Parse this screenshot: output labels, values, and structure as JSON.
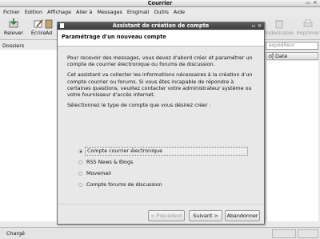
{
  "window": {
    "title": "Courrier"
  },
  "menubar": {
    "items": [
      "Fichier",
      "Edition",
      "Affichage",
      "Aller à",
      "Messages",
      "Enigmail",
      "Outils",
      "Aide"
    ]
  },
  "toolbar": {
    "relever": "Relever",
    "ecrire": "Écrire",
    "ad_partial": "Ad",
    "indesirable": "Indésirable",
    "imprimer": "Imprimer"
  },
  "folders": {
    "header": "Dossiers"
  },
  "search": {
    "placeholder": "expéditeur"
  },
  "columns": {
    "date": "Date"
  },
  "status": {
    "text": "Chargé"
  },
  "dialog": {
    "title": "Assistant de création de compte",
    "heading": "Paramétrage d'un nouveau compte",
    "paragraph1": "Pour recevoir des messages, vous devez d'abord créer et paramétrer un compte de courrier électronique ou forums de discussion.",
    "paragraph2": "Cet assistant va collecter les informations nécessaires à la création d'un compte courrier ou forums. Si vous êtes incapable de répondre à certaines questions, veuillez contacter votre administrateur système ou votre fournisseur d'accès internet.",
    "paragraph3": "Sélectionnez le type de compte que vous désirez créer :",
    "options": [
      {
        "label": "Compte courrier électronique",
        "selected": true
      },
      {
        "label": "RSS News & Blogs",
        "selected": false
      },
      {
        "label": "Movemail",
        "selected": false
      },
      {
        "label": "Compte forums de discussion",
        "selected": false
      }
    ],
    "buttons": {
      "previous": "< Précédent",
      "next": "Suivant >",
      "cancel": "Abandonner"
    }
  }
}
